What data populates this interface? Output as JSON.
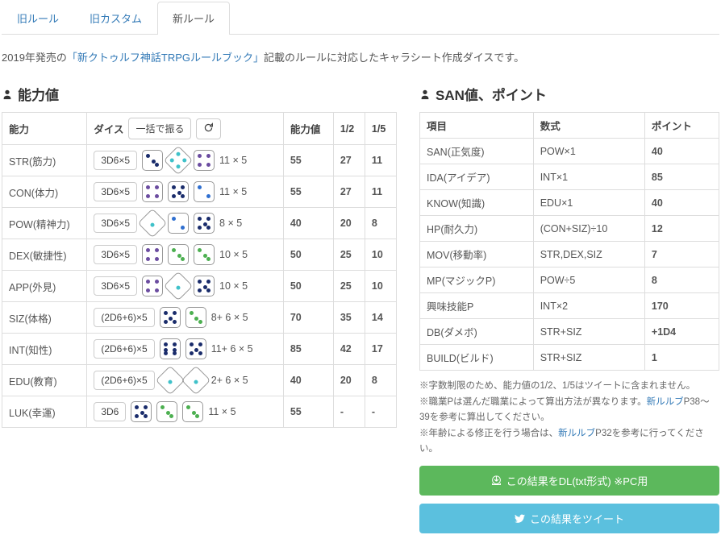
{
  "tabs": [
    "旧ルール",
    "旧カスタム",
    "新ルール"
  ],
  "active_tab": 2,
  "intro_pre": "2019年発売の",
  "intro_link": "「新クトゥルフ神話TRPGルールブック」",
  "intro_post": "記載のルールに対応したキャラシート作成ダイスです。",
  "left_title": "能力値",
  "right_title": "SAN値、ポイント",
  "ability_headers": [
    "能力",
    "ダイス",
    "能力値",
    "1/2",
    "1/5"
  ],
  "roll_all": "一括で振る",
  "abilities": [
    {
      "name": "STR(筋力)",
      "btn": "3D6×5",
      "dice": [
        {
          "n": 3,
          "c": "navy",
          "t": 0
        },
        {
          "n": 4,
          "c": "teal",
          "t": 1
        },
        {
          "n": 4,
          "c": "purple",
          "t": 0
        }
      ],
      "calc": "11 × 5",
      "val": "55",
      "h": "27",
      "f": "11"
    },
    {
      "name": "CON(体力)",
      "btn": "3D6×5",
      "dice": [
        {
          "n": 4,
          "c": "purple",
          "t": 0
        },
        {
          "n": 5,
          "c": "navy",
          "t": 0
        },
        {
          "n": 2,
          "c": "blue",
          "t": 0
        }
      ],
      "calc": "11 × 5",
      "val": "55",
      "h": "27",
      "f": "11"
    },
    {
      "name": "POW(精神力)",
      "btn": "3D6×5",
      "dice": [
        {
          "n": 1,
          "c": "teal",
          "t": 1
        },
        {
          "n": 2,
          "c": "blue",
          "t": 0
        },
        {
          "n": 5,
          "c": "navy",
          "t": 0
        }
      ],
      "calc": "8 × 5",
      "val": "40",
      "h": "20",
      "f": "8"
    },
    {
      "name": "DEX(敏捷性)",
      "btn": "3D6×5",
      "dice": [
        {
          "n": 4,
          "c": "purple",
          "t": 0
        },
        {
          "n": 3,
          "c": "green",
          "t": 0
        },
        {
          "n": 3,
          "c": "green",
          "t": 0
        }
      ],
      "calc": "10 × 5",
      "val": "50",
      "h": "25",
      "f": "10"
    },
    {
      "name": "APP(外見)",
      "btn": "3D6×5",
      "dice": [
        {
          "n": 4,
          "c": "purple",
          "t": 0
        },
        {
          "n": 1,
          "c": "teal",
          "t": 1
        },
        {
          "n": 5,
          "c": "navy",
          "t": 0
        }
      ],
      "calc": "10 × 5",
      "val": "50",
      "h": "25",
      "f": "10"
    },
    {
      "name": "SIZ(体格)",
      "btn": "(2D6+6)×5",
      "dice": [
        {
          "n": 5,
          "c": "navy",
          "t": 0
        },
        {
          "n": 3,
          "c": "green",
          "t": 0
        }
      ],
      "calc": "8+ 6 × 5",
      "val": "70",
      "h": "35",
      "f": "14"
    },
    {
      "name": "INT(知性)",
      "btn": "(2D6+6)×5",
      "dice": [
        {
          "n": 6,
          "c": "navy",
          "t": 0
        },
        {
          "n": 5,
          "c": "navy",
          "t": 0
        }
      ],
      "calc": "11+ 6 × 5",
      "val": "85",
      "h": "42",
      "f": "17"
    },
    {
      "name": "EDU(教育)",
      "btn": "(2D6+6)×5",
      "dice": [
        {
          "n": 1,
          "c": "teal",
          "t": 1
        },
        {
          "n": 1,
          "c": "teal",
          "t": 1
        }
      ],
      "calc": "2+ 6 × 5",
      "val": "40",
      "h": "20",
      "f": "8"
    },
    {
      "name": "LUK(幸運)",
      "btn": "3D6",
      "dice": [
        {
          "n": 5,
          "c": "navy",
          "t": 0
        },
        {
          "n": 3,
          "c": "green",
          "t": 0
        },
        {
          "n": 3,
          "c": "green",
          "t": 0
        }
      ],
      "calc": "11 × 5",
      "val": "55",
      "h": "-",
      "f": "-"
    }
  ],
  "point_headers": [
    "項目",
    "数式",
    "ポイント"
  ],
  "points": [
    {
      "name": "SAN(正気度)",
      "f": "POW×1",
      "v": "40"
    },
    {
      "name": "IDA(アイデア)",
      "f": "INT×1",
      "v": "85"
    },
    {
      "name": "KNOW(知識)",
      "f": "EDU×1",
      "v": "40"
    },
    {
      "name": "HP(耐久力)",
      "f": "(CON+SIZ)÷10",
      "v": "12"
    },
    {
      "name": "MOV(移動率)",
      "f": "STR,DEX,SIZ",
      "v": "7"
    },
    {
      "name": "MP(マジックP)",
      "f": "POW÷5",
      "v": "8"
    },
    {
      "name": "興味技能P",
      "f": "INT×2",
      "v": "170"
    },
    {
      "name": "DB(ダメボ)",
      "f": "STR+SIZ",
      "v": "+1D4"
    },
    {
      "name": "BUILD(ビルド)",
      "f": "STR+SIZ",
      "v": "1"
    }
  ],
  "notes": [
    {
      "t": "※字数制限のため、能力値の1/2、1/5はツイートに含まれません。"
    },
    {
      "t": "※職業Pは選んだ職業によって算出方法が異なります。",
      "l": "新ルルブ",
      "a": "P38〜39を参考に算出してください。"
    },
    {
      "t": "※年齢による修正を行う場合は、",
      "l": "新ルルブ",
      "a": "P32を参考に行ってください。"
    }
  ],
  "dl_btn": "この結果をDL(txt形式) ※PC用",
  "tw_btn": "この結果をツイート"
}
